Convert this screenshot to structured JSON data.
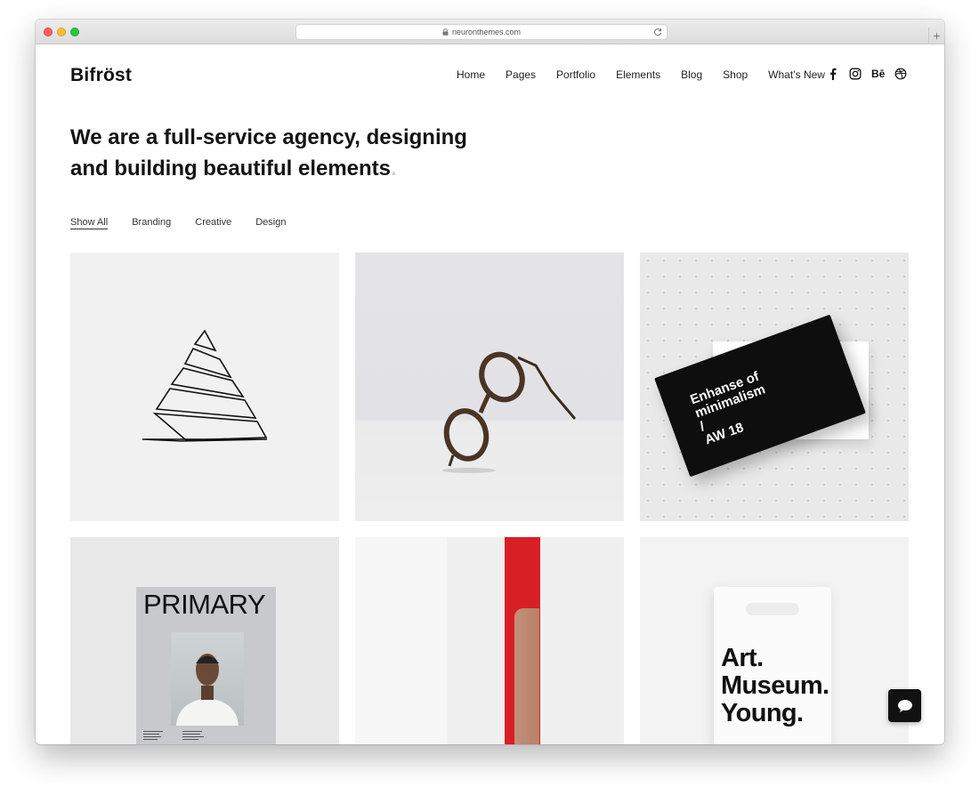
{
  "browser": {
    "url": "neuronthemes.com",
    "new_tab_label": "+"
  },
  "site": {
    "logo": "Bifröst",
    "nav": [
      "Home",
      "Pages",
      "Portfolio",
      "Elements",
      "Blog",
      "Shop",
      "What’s New"
    ],
    "social": [
      "facebook-icon",
      "instagram-icon",
      "behance-icon",
      "dribbble-icon"
    ],
    "behance_label": "Bē"
  },
  "hero": {
    "line1": "We are a full-service agency, designing",
    "line2": "and building beautiful elements",
    "period": "."
  },
  "filters": {
    "items": [
      "Show All",
      "Branding",
      "Creative",
      "Design"
    ],
    "active": "Show All"
  },
  "portfolio": {
    "tile3_card": {
      "line1": "Enhanse of",
      "line2": "minimalism",
      "line3": "/",
      "line4": "AW 18"
    },
    "tile4_magazine": {
      "title": "PRIMARY"
    },
    "tile6_bag": {
      "line1": "Art.",
      "line2": "Museum.",
      "line3": "Young."
    }
  },
  "chat": {
    "icon": "chat-bubble-icon"
  }
}
